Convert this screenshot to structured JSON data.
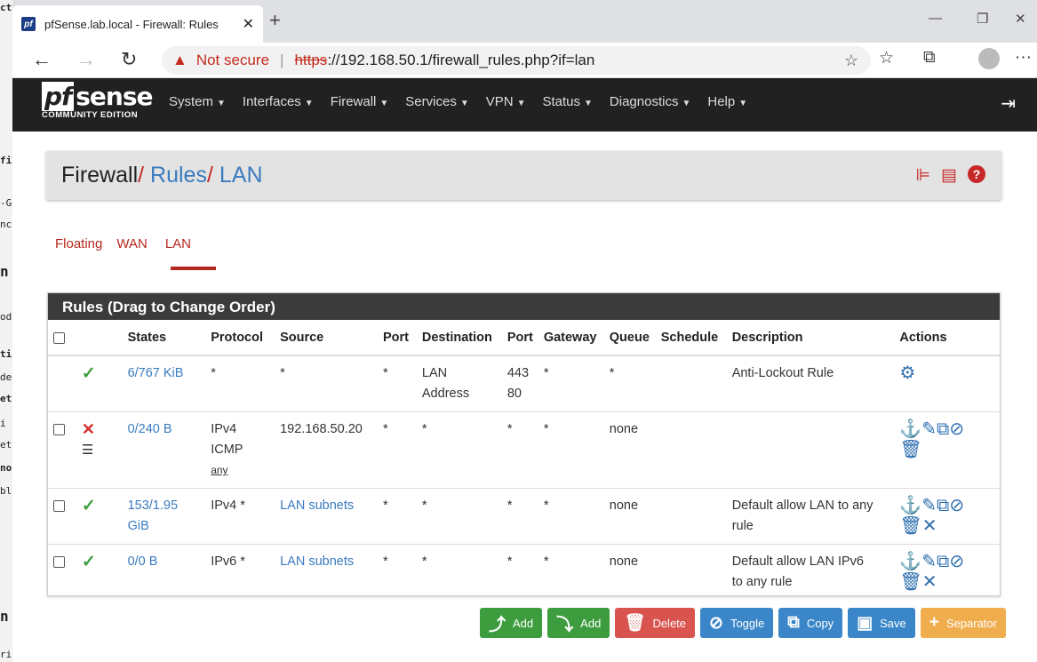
{
  "browser": {
    "tab_title": "pfSense.lab.local - Firewall: Rules",
    "favicon": "pf",
    "url_warning": "Not secure",
    "url_scheme": "https",
    "url_rest": "://192.168.50.1/firewall_rules.php?if=lan"
  },
  "background_strip": [
    "ct",
    "fil",
    "-G",
    "nc",
    "n",
    "od",
    "ti",
    "de",
    "et",
    "i",
    "ett",
    "no",
    "bl",
    "n",
    "ri"
  ],
  "pfsense": {
    "logo_main": "sense",
    "logo_pf": "pf",
    "logo_sub": "COMMUNITY EDITION",
    "menu": [
      "System",
      "Interfaces",
      "Firewall",
      "Services",
      "VPN",
      "Status",
      "Diagnostics",
      "Help"
    ]
  },
  "breadcrumb": {
    "root": "Firewall",
    "rules": "Rules",
    "current": "LAN"
  },
  "tabs": [
    "Floating",
    "WAN",
    "LAN"
  ],
  "panel_title": "Rules (Drag to Change Order)",
  "columns": [
    "States",
    "Protocol",
    "Source",
    "Port",
    "Destination",
    "Port",
    "Gateway",
    "Queue",
    "Schedule",
    "Description",
    "Actions"
  ],
  "rows": [
    {
      "states": "6/767 KiB",
      "protocol": "*",
      "protocol2": "",
      "protocol3": "",
      "source": "*",
      "sport": "*",
      "dest": "LAN",
      "dest2": "Address",
      "dport": "443",
      "dport2": "80",
      "gateway": "*",
      "queue": "*",
      "schedule": "",
      "desc": "Anti-Lockout Rule",
      "desc2": ""
    },
    {
      "states": "0/240 B",
      "protocol": "IPv4",
      "protocol2": "ICMP",
      "protocol3": "any",
      "source": "192.168.50.20",
      "sport": "*",
      "dest": "*",
      "dest2": "",
      "dport": "*",
      "dport2": "",
      "gateway": "*",
      "queue": "none",
      "schedule": "",
      "desc": "",
      "desc2": ""
    },
    {
      "states": "153/1.95",
      "states2": "GiB",
      "protocol": "IPv4 *",
      "protocol2": "",
      "protocol3": "",
      "source": "LAN subnets",
      "sport": "*",
      "dest": "*",
      "dest2": "",
      "dport": "*",
      "dport2": "",
      "gateway": "*",
      "queue": "none",
      "schedule": "",
      "desc": "Default allow LAN to any",
      "desc2": "rule"
    },
    {
      "states": "0/0 B",
      "protocol": "IPv6 *",
      "protocol2": "",
      "protocol3": "",
      "source": "LAN subnets",
      "sport": "*",
      "dest": "*",
      "dest2": "",
      "dport": "*",
      "dport2": "",
      "gateway": "*",
      "queue": "none",
      "schedule": "",
      "desc": "Default allow LAN IPv6",
      "desc2": "to any rule"
    }
  ],
  "buttons": {
    "add_top": "Add",
    "add_bottom": "Add",
    "delete": "Delete",
    "toggle": "Toggle",
    "copy": "Copy",
    "save": "Save",
    "separator": "Separator"
  }
}
